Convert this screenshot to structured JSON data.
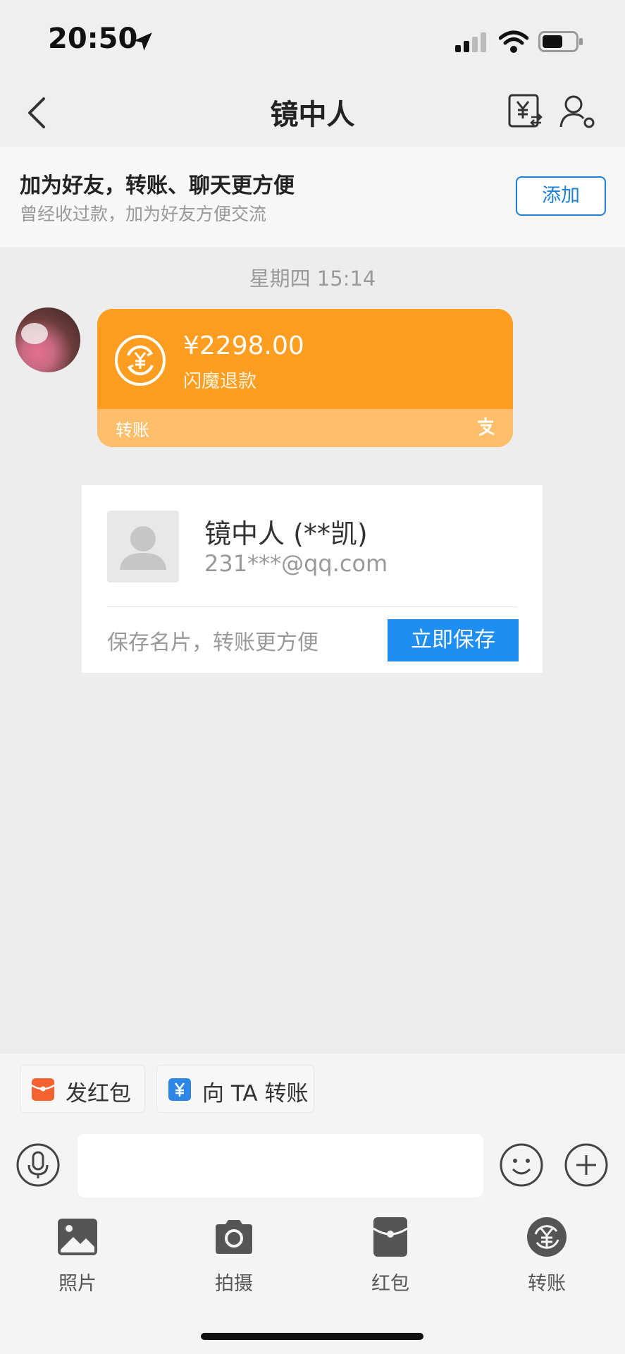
{
  "status_bar": {
    "time": "20:50"
  },
  "header": {
    "title": "镜中人"
  },
  "banner": {
    "title": "加为好友，转账、聊天更方便",
    "subtitle": "曾经收过款，加为好友方便交流",
    "add_label": "添加"
  },
  "chat": {
    "timestamp": "星期四 15:14",
    "transfer": {
      "amount": "¥2298.00",
      "note": "闪魔退款",
      "label": "转账"
    },
    "name_card": {
      "name": "镜中人 (**凯)",
      "email": "231***@qq.com",
      "hint": "保存名片，转账更方便",
      "save_label": "立即保存"
    }
  },
  "quick_actions": {
    "red_packet": "发红包",
    "transfer": "向 TA 转账"
  },
  "input": {
    "placeholder": ""
  },
  "panel": {
    "items": [
      {
        "label": "照片",
        "icon": "photo-icon"
      },
      {
        "label": "拍摄",
        "icon": "camera-icon"
      },
      {
        "label": "红包",
        "icon": "red-packet-icon"
      },
      {
        "label": "转账",
        "icon": "transfer-icon"
      }
    ]
  },
  "colors": {
    "transfer_card": "#fe9d1f",
    "link_blue": "#1d7fd8",
    "save_button": "#1e8ff0",
    "red_packet": "#f4622f"
  }
}
